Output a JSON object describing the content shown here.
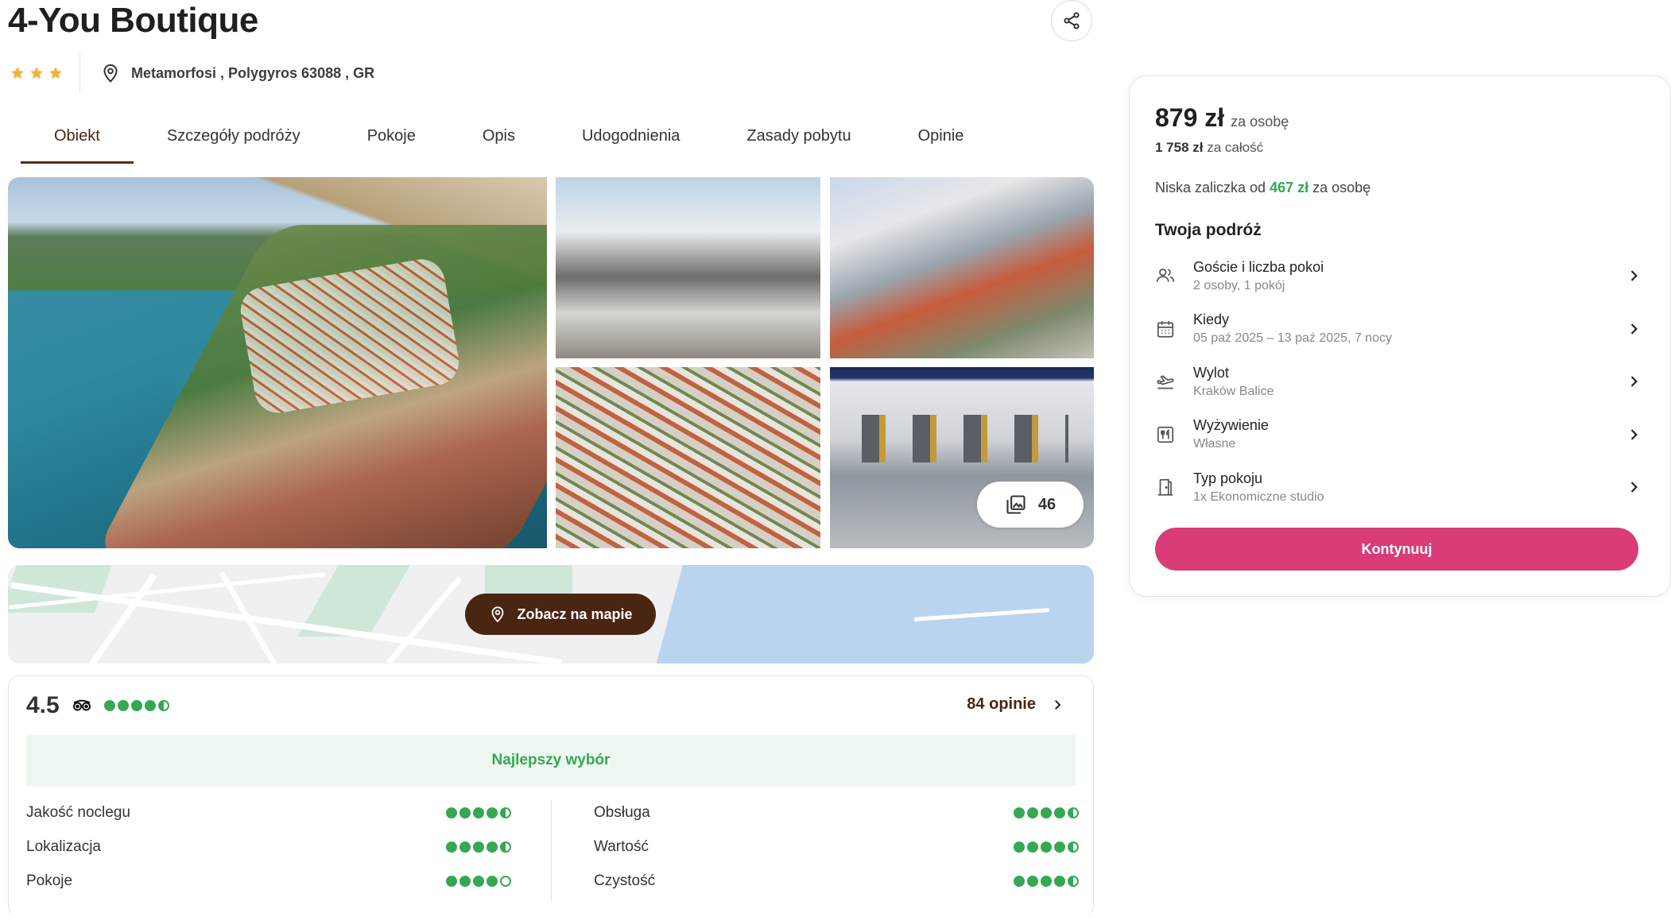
{
  "hotel": {
    "title": "4-You Boutique",
    "stars": 3,
    "address": "Metamorfosi , Polygyros 63088 , GR"
  },
  "tabs": [
    {
      "label": "Obiekt",
      "active": true
    },
    {
      "label": "Szczegóły podróży",
      "active": false
    },
    {
      "label": "Pokoje",
      "active": false
    },
    {
      "label": "Opis",
      "active": false
    },
    {
      "label": "Udogodnienia",
      "active": false
    },
    {
      "label": "Zasady pobytu",
      "active": false
    },
    {
      "label": "Opinie",
      "active": false
    }
  ],
  "gallery": {
    "photo_count": "46"
  },
  "map": {
    "button_label": "Zobacz na mapie"
  },
  "reviews": {
    "score": "4.5",
    "score_dots": 4.5,
    "count_label": "84 opinie",
    "best_choice": "Najlepszy wybór",
    "categories_left": [
      {
        "label": "Jakość noclegu",
        "rating": 4.5
      },
      {
        "label": "Lokalizacja",
        "rating": 4.5
      },
      {
        "label": "Pokoje",
        "rating": 4
      }
    ],
    "categories_right": [
      {
        "label": "Obsługa",
        "rating": 4.5
      },
      {
        "label": "Wartość",
        "rating": 4.5
      },
      {
        "label": "Czystość",
        "rating": 4.5
      }
    ]
  },
  "booking": {
    "price": "879 zł",
    "price_unit": "za osobę",
    "total_amount": "1 758 zł",
    "total_unit": "za całość",
    "deposit_prefix": "Niska zaliczka od",
    "deposit_amount": "467 zł",
    "deposit_suffix": "za osobę",
    "trip_title": "Twoja podróż",
    "trip_items": [
      {
        "icon": "guests-icon",
        "label": "Goście i liczba pokoi",
        "value": "2 osoby, 1 pokój"
      },
      {
        "icon": "calendar-icon",
        "label": "Kiedy",
        "value": "05 paź 2025 – 13 paź 2025, 7 nocy"
      },
      {
        "icon": "plane-departure-icon",
        "label": "Wylot",
        "value": "Kraków Balice"
      },
      {
        "icon": "meal-icon",
        "label": "Wyżywienie",
        "value": "Własne"
      },
      {
        "icon": "door-icon",
        "label": "Typ pokoju",
        "value": "1x Ekonomiczne studio"
      }
    ],
    "cta_label": "Kontynuuj"
  },
  "colors": {
    "accent_brown": "#4a2512",
    "cta_pink": "#d93c76",
    "rating_green": "#34a853",
    "star_gold": "#f2b33d"
  }
}
